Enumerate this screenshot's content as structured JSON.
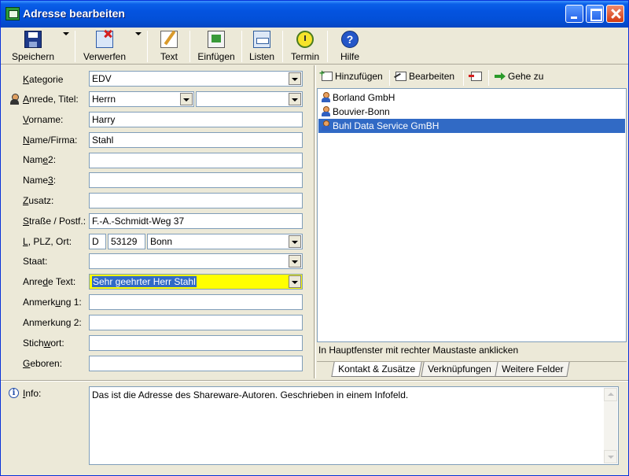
{
  "window": {
    "title": "Adresse bearbeiten"
  },
  "toolbar": {
    "save": "Speichern",
    "discard": "Verwerfen",
    "text": "Text",
    "insert": "Einfügen",
    "lists": "Listen",
    "appointment": "Termin",
    "help": "Hilfe"
  },
  "form": {
    "category": {
      "label_pre": "",
      "label_u": "K",
      "label_post": "ategorie",
      "value": "EDV"
    },
    "salutation": {
      "label_pre": "",
      "label_u": "A",
      "label_post": "nrede, Titel:",
      "value": "Herrn",
      "title_value": ""
    },
    "firstname": {
      "label_pre": "",
      "label_u": "V",
      "label_post": "orname:",
      "value": "Harry"
    },
    "name": {
      "label_pre": "",
      "label_u": "N",
      "label_post": "ame/Firma:",
      "value": "Stahl"
    },
    "name2": {
      "label_pre": "Nam",
      "label_u": "e",
      "label_post": "2:",
      "value": ""
    },
    "name3": {
      "label_pre": "Name",
      "label_u": "3",
      "label_post": ":",
      "value": ""
    },
    "addition": {
      "label_pre": "",
      "label_u": "Z",
      "label_post": "usatz:",
      "value": ""
    },
    "street": {
      "label_pre": "",
      "label_u": "S",
      "label_post": "traße / Postf.:",
      "value": "F.-A.-Schmidt-Weg 37"
    },
    "zipcity": {
      "label_pre": "",
      "label_u": "L",
      "label_post": ", PLZ, Ort:",
      "country_code": "D",
      "zip": "53129",
      "city": "Bonn"
    },
    "state": {
      "label": "Staat:",
      "value": ""
    },
    "salutation_text": {
      "label_pre": "Anre",
      "label_u": "d",
      "label_post": "e Text:",
      "value": "Sehr geehrter Herr Stahl"
    },
    "note1": {
      "label_pre": "Anmerk",
      "label_u": "u",
      "label_post": "ng 1:",
      "value": ""
    },
    "note2": {
      "label": "Anmerkung 2:",
      "value": ""
    },
    "keyword": {
      "label_pre": "Stich",
      "label_u": "w",
      "label_post": "ort:",
      "value": ""
    },
    "born": {
      "label_pre": "",
      "label_u": "G",
      "label_post": "eboren:",
      "value": ""
    }
  },
  "links_panel": {
    "add": "Hinzufügen",
    "edit": "Bearbeiten",
    "goto": "Gehe zu",
    "items": [
      "Borland GmbH",
      "Bouvier-Bonn",
      "Buhl Data Service GmBH"
    ],
    "hint": "In Hauptfenster mit rechter Maustaste anklicken",
    "tabs": [
      "Kontakt & Zusätze",
      "Verknüpfungen",
      "Weitere Felder"
    ]
  },
  "info": {
    "label_pre": "",
    "label_u": "I",
    "label_post": "nfo:",
    "value": "Das ist die Adresse des Shareware-Autoren. Geschrieben in einem Infofeld."
  }
}
